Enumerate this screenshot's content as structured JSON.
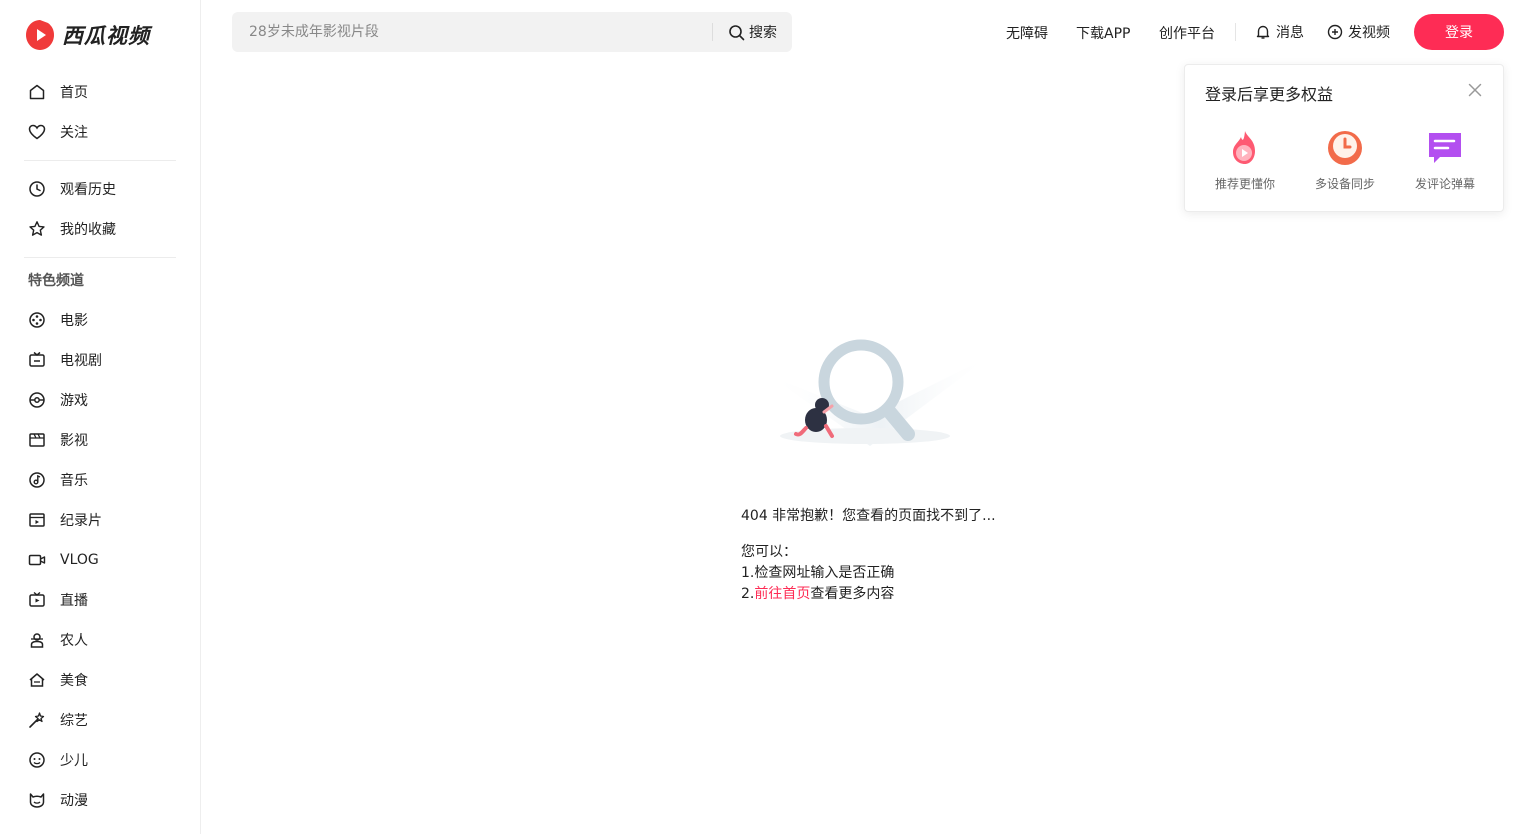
{
  "app": {
    "logo_text": "西瓜视频"
  },
  "sidebar": {
    "primary": [
      {
        "label": "首页",
        "icon": "home-icon"
      },
      {
        "label": "关注",
        "icon": "heart-icon"
      }
    ],
    "secondary": [
      {
        "label": "观看历史",
        "icon": "clock-icon"
      },
      {
        "label": "我的收藏",
        "icon": "star-icon"
      }
    ],
    "section_title": "特色频道",
    "channels": [
      {
        "label": "电影",
        "icon": "film-reel-icon"
      },
      {
        "label": "电视剧",
        "icon": "tv-icon"
      },
      {
        "label": "游戏",
        "icon": "gamepad-icon"
      },
      {
        "label": "影视",
        "icon": "clapperboard-icon"
      },
      {
        "label": "音乐",
        "icon": "music-icon"
      },
      {
        "label": "纪录片",
        "icon": "documentary-icon"
      },
      {
        "label": "VLOG",
        "icon": "camera-icon"
      },
      {
        "label": "直播",
        "icon": "live-tv-icon"
      },
      {
        "label": "农人",
        "icon": "farmer-icon"
      },
      {
        "label": "美食",
        "icon": "food-icon"
      },
      {
        "label": "综艺",
        "icon": "magic-wand-icon"
      },
      {
        "label": "少儿",
        "icon": "kids-face-icon"
      },
      {
        "label": "动漫",
        "icon": "anime-face-icon"
      }
    ]
  },
  "search": {
    "placeholder": "28岁未成年影视片段",
    "button_label": "搜索"
  },
  "header": {
    "links": [
      "无障碍",
      "下载APP",
      "创作平台"
    ],
    "messages_label": "消息",
    "upload_label": "发视频",
    "login_label": "登录"
  },
  "popover": {
    "title": "登录后享更多权益",
    "benefits": [
      {
        "label": "推荐更懂你",
        "icon": "flame-play-icon"
      },
      {
        "label": "多设备同步",
        "icon": "sync-clock-icon"
      },
      {
        "label": "发评论弹幕",
        "icon": "comment-icon"
      }
    ]
  },
  "error": {
    "title": "404 非常抱歉！您查看的页面找不到了...",
    "suggest_intro": "您可以：",
    "suggest_1": "1.检查网址输入是否正确",
    "suggest_2_prefix": "2.",
    "suggest_2_link": "前往首页",
    "suggest_2_suffix": "查看更多内容"
  },
  "colors": {
    "accent": "#fe2c55",
    "logo_red": "#f03a3a"
  }
}
